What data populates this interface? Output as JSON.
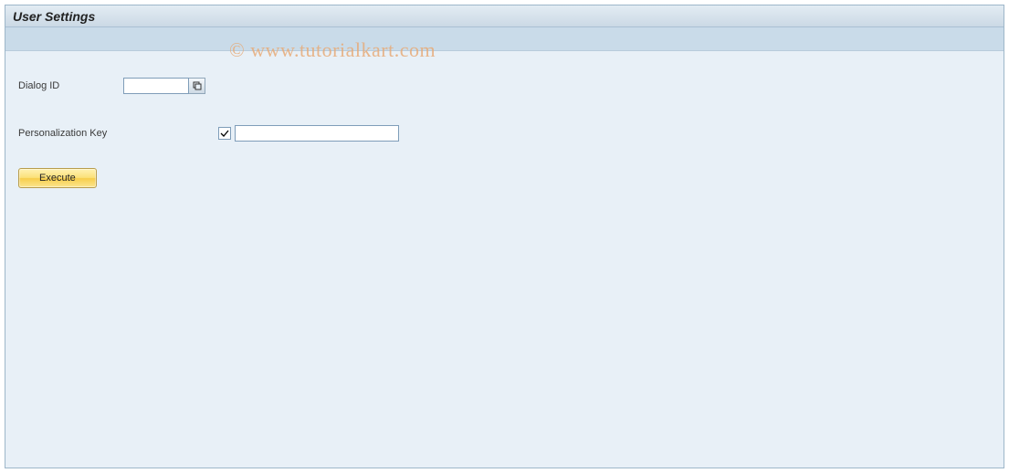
{
  "window": {
    "title": "User Settings"
  },
  "fields": {
    "dialog_id": {
      "label": "Dialog ID",
      "value": ""
    },
    "pers_key": {
      "label": "Personalization Key",
      "checked": true,
      "value": ""
    }
  },
  "buttons": {
    "execute": "Execute"
  },
  "watermark": "© www.tutorialkart.com"
}
